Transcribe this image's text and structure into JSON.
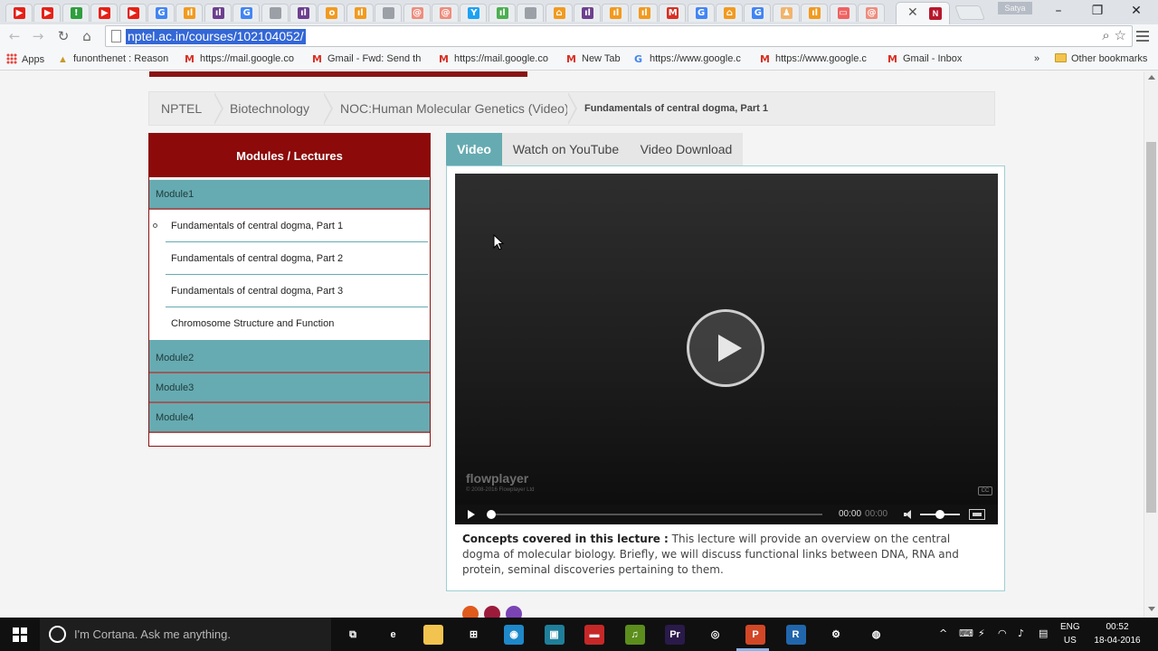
{
  "browser": {
    "url": "nptel.ac.in/courses/102104052/",
    "profile_name": "Satya",
    "tab_icons": [
      {
        "icon": "youtube-icon",
        "color": "#e62117",
        "glyph": "▶"
      },
      {
        "icon": "youtube-icon",
        "color": "#e62117",
        "glyph": "▶"
      },
      {
        "icon": "green-round-icon",
        "color": "#2e9e3e",
        "glyph": "!"
      },
      {
        "icon": "youtube-icon",
        "color": "#e62117",
        "glyph": "▶"
      },
      {
        "icon": "youtube-icon",
        "color": "#e62117",
        "glyph": "▶"
      },
      {
        "icon": "google-icon",
        "color": "#4285f4",
        "glyph": "G"
      },
      {
        "icon": "chart-icon",
        "color": "#f29a1f",
        "glyph": "ıl"
      },
      {
        "icon": "purple-bars-icon",
        "color": "#6d3f8f",
        "glyph": "ıl"
      },
      {
        "icon": "google-icon",
        "color": "#4285f4",
        "glyph": "G"
      },
      {
        "icon": "document-icon",
        "color": "#9aa0a6",
        "glyph": ""
      },
      {
        "icon": "purple-bars-icon",
        "color": "#6d3f8f",
        "glyph": "ıl"
      },
      {
        "icon": "orange-round-icon",
        "color": "#f29a1f",
        "glyph": "o"
      },
      {
        "icon": "chart-icon",
        "color": "#f29a1f",
        "glyph": "ıl"
      },
      {
        "icon": "document-icon",
        "color": "#9aa0a6",
        "glyph": ""
      },
      {
        "icon": "spiral-icon",
        "color": "#ef8c7c",
        "glyph": "@"
      },
      {
        "icon": "spiral-icon",
        "color": "#ef8c7c",
        "glyph": "@"
      },
      {
        "icon": "twitter-box-icon",
        "color": "#1da1f2",
        "glyph": "Y"
      },
      {
        "icon": "green-chart-icon",
        "color": "#4caf50",
        "glyph": "ıl"
      },
      {
        "icon": "document-icon",
        "color": "#9aa0a6",
        "glyph": ""
      },
      {
        "icon": "home-icon",
        "color": "#f29a1f",
        "glyph": "⌂"
      },
      {
        "icon": "purple-bars-icon",
        "color": "#6d3f8f",
        "glyph": "ıl"
      },
      {
        "icon": "chart-icon",
        "color": "#f29a1f",
        "glyph": "ıl"
      },
      {
        "icon": "chart-icon",
        "color": "#f29a1f",
        "glyph": "ıl"
      },
      {
        "icon": "gmail-icon",
        "color": "#d93025",
        "glyph": "M"
      },
      {
        "icon": "google-icon",
        "color": "#4285f4",
        "glyph": "G"
      },
      {
        "icon": "home-icon",
        "color": "#f29a1f",
        "glyph": "⌂"
      },
      {
        "icon": "google-icon",
        "color": "#4285f4",
        "glyph": "G"
      },
      {
        "icon": "person-icon",
        "color": "#f2b46a",
        "glyph": "♟"
      },
      {
        "icon": "chart-icon",
        "color": "#f29a1f",
        "glyph": "ıl"
      },
      {
        "icon": "pink-box-icon",
        "color": "#f06262",
        "glyph": "▭"
      },
      {
        "icon": "spiral-icon",
        "color": "#ef8c7c",
        "glyph": "@"
      }
    ],
    "active_tab_favicon": "N",
    "window_controls": {
      "minimize": "–",
      "restore": "❐",
      "close": "✕"
    }
  },
  "bookmarks": [
    {
      "label": "Apps",
      "icon": "apps-grid-icon"
    },
    {
      "label": "funonthenet : Reason",
      "icon": "funonthenet-icon"
    },
    {
      "label": "https://mail.google.co",
      "icon": "gmail-icon"
    },
    {
      "label": "Gmail - Fwd: Send th",
      "icon": "gmail-icon"
    },
    {
      "label": "https://mail.google.co",
      "icon": "gmail-icon"
    },
    {
      "label": "New Tab",
      "icon": "gmail-icon"
    },
    {
      "label": "https://www.google.c",
      "icon": "google-icon"
    },
    {
      "label": "https://www.google.c",
      "icon": "gmail-icon"
    },
    {
      "label": "Gmail - Inbox",
      "icon": "gmail-icon"
    }
  ],
  "bookmarks_overflow": "»",
  "other_bookmarks": "Other bookmarks",
  "breadcrumb": {
    "items": [
      "NPTEL",
      "Biotechnology",
      "NOC:Human Molecular Genetics (Video)"
    ],
    "current": "Fundamentals of central dogma, Part 1"
  },
  "sidebar": {
    "title": "Modules / Lectures",
    "modules": [
      "Module1",
      "Module2",
      "Module3",
      "Module4"
    ],
    "lectures": [
      "Fundamentals of central dogma, Part 1",
      "Fundamentals of central dogma, Part 2",
      "Fundamentals of central dogma, Part 3",
      "Chromosome Structure and Function"
    ],
    "active_lecture_index": 0
  },
  "tabs": [
    "Video",
    "Watch on YouTube",
    "Video Download"
  ],
  "active_tab": "Video",
  "player": {
    "brand": "flowplayer",
    "copyright": "© 2008-2016 Flowplayer Ltd",
    "cc_label": "CC",
    "elapsed": "00:00",
    "duration": "00:00",
    "volume_fraction": 0.5,
    "progress_fraction": 0
  },
  "concepts": {
    "label": "Concepts covered in this lecture :",
    "text": " This lecture will provide an overview on the central dogma of molecular biology. Briefly, we will discuss functional links between DNA, RNA and protein, seminal discoveries pertaining to them."
  },
  "social_colors": [
    "#e05a1c",
    "#9c1b3a",
    "#7b44b5"
  ],
  "taskbar": {
    "cortana_placeholder": "I'm Cortana. Ask me anything.",
    "apps": [
      {
        "name": "task-view-icon",
        "color": "#101010",
        "glyph": "⧉"
      },
      {
        "name": "edge-icon",
        "color": "#101010",
        "glyph": "e"
      },
      {
        "name": "file-explorer-icon",
        "color": "#f2c44f",
        "glyph": ""
      },
      {
        "name": "store-icon",
        "color": "#101010",
        "glyph": "⊞"
      },
      {
        "name": "media-icon",
        "color": "#1e88c8",
        "glyph": "◉"
      },
      {
        "name": "app-teal-icon",
        "color": "#1f7f9a",
        "glyph": "▣"
      },
      {
        "name": "app-red-icon",
        "color": "#c62828",
        "glyph": "▬"
      },
      {
        "name": "music-icon",
        "color": "#5b8e1c",
        "glyph": "♫"
      },
      {
        "name": "premiere-icon",
        "color": "#2a1a4a",
        "glyph": "Pr"
      },
      {
        "name": "chrome-icon",
        "color": "#101010",
        "glyph": "◎"
      },
      {
        "name": "powerpoint-icon",
        "color": "#d24726",
        "glyph": "P"
      },
      {
        "name": "r-icon",
        "color": "#2166ac",
        "glyph": "R"
      },
      {
        "name": "settings-icon",
        "color": "#101010",
        "glyph": "⚙"
      },
      {
        "name": "color-circle-icon",
        "color": "#101010",
        "glyph": "◍"
      }
    ],
    "language": "ENG",
    "region": "US",
    "time": "00:52",
    "date": "18-04-2016"
  }
}
